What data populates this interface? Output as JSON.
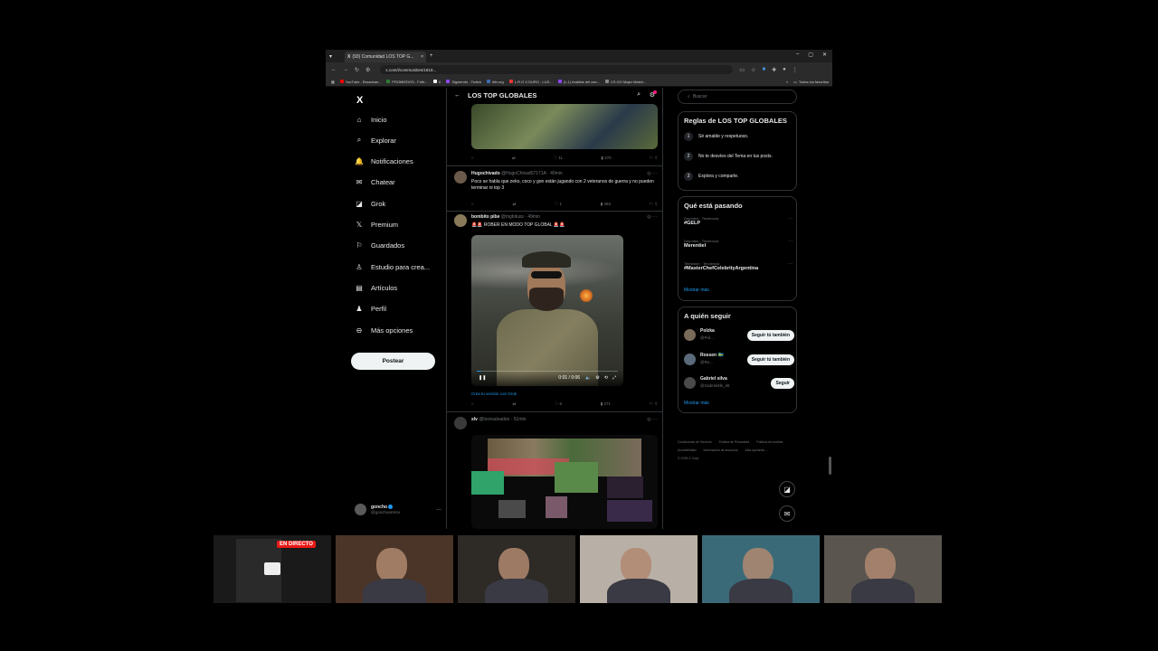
{
  "browser": {
    "tab_title": "(93) Comunidad LOS TOP G...",
    "url": "x.com/i/communities/1818...",
    "bookmarks": [
      {
        "label": "YouTube - Broadcas...",
        "color": "#ff0000"
      },
      {
        "label": "PROMIEDOS - Fútb...",
        "color": "#2e7d32"
      },
      {
        "label": "X",
        "color": "#ffffff"
      },
      {
        "label": "Siguiendo - Twitch",
        "color": "#9146ff"
      },
      {
        "label": "hltv.org",
        "color": "#3d6fb4"
      },
      {
        "label": "L.R.O X DURO - LUS...",
        "color": "#e53935"
      },
      {
        "label": "(1-1) Análisis del can...",
        "color": "#9146ff"
      },
      {
        "label": "CS:GO Major Match...",
        "color": "#888888"
      }
    ],
    "all_bookmarks": "Todos los favoritos"
  },
  "nav": {
    "logo": "X",
    "items": [
      {
        "label": "Inicio",
        "icon": "home-icon",
        "glyph": "⌂"
      },
      {
        "label": "Explorar",
        "icon": "search-icon",
        "glyph": "⌕"
      },
      {
        "label": "Notificaciones",
        "icon": "bell-icon",
        "glyph": "🔔"
      },
      {
        "label": "Chatear",
        "icon": "mail-icon",
        "glyph": "✉"
      },
      {
        "label": "Grok",
        "icon": "grok-icon",
        "glyph": "◪"
      },
      {
        "label": "Premium",
        "icon": "x-premium-icon",
        "glyph": "𝕏"
      },
      {
        "label": "Guardados",
        "icon": "bookmark-icon",
        "glyph": "⚐"
      },
      {
        "label": "Estudio para crea...",
        "icon": "studio-icon",
        "glyph": "♙"
      },
      {
        "label": "Artículos",
        "icon": "article-icon",
        "glyph": "▤"
      },
      {
        "label": "Perfil",
        "icon": "person-icon",
        "glyph": "♟"
      },
      {
        "label": "Más opciones",
        "icon": "more-circle-icon",
        "glyph": "⊖"
      }
    ],
    "post_button": "Postear",
    "account": {
      "name": "goncho",
      "handle": "@gonchoarreso"
    }
  },
  "feed": {
    "title": "LOS TOP GLOBALES",
    "tweets": [
      {
        "author": "",
        "handle": "",
        "time": "",
        "text": "",
        "replies": "",
        "likes": "11",
        "views": "270"
      },
      {
        "author": "Hugochivado",
        "handle": "@HugoChivad07171A",
        "time": "40min",
        "text": "Poco se habla que zeko, coco y gon están jugando con 2 veteranos de guerra y no pueden terminar ni top 3",
        "likes": "1",
        "views": "283"
      },
      {
        "author": "bombito pibe",
        "handle": "@mgbituss",
        "time": "49min",
        "text": "🚨🚨 ROBER EN MODO TOP GLOBAL 🚨🚨",
        "video_time": "0:01 / 0:06",
        "grok_link": "Crea tu versión con Grok",
        "likes": "6",
        "views": "271"
      },
      {
        "author": "slv",
        "handle": "@losvsalvadon",
        "time": "51min",
        "text": ""
      }
    ]
  },
  "sidebar": {
    "search_placeholder": "Buscar",
    "rules_title": "Reglas de LOS TOP GLOBALES",
    "rules": [
      {
        "num": "1",
        "text": "Sé amable y respetuoso."
      },
      {
        "num": "2",
        "text": "No te desvíes del Tema en tus posts."
      },
      {
        "num": "3",
        "text": "Explora y comparte."
      }
    ],
    "trends_title": "Qué está pasando",
    "trends": [
      {
        "meta": "Deportes · Tendencia",
        "name": "#GELP"
      },
      {
        "meta": "Deportes · Tendencia",
        "name": "Merentiel"
      },
      {
        "meta": "Televisión · Tendencia",
        "name": "#MasterChefCelebrityArgentina"
      }
    ],
    "show_more": "Mostrar más",
    "follow_title": "A quién seguir",
    "follow": [
      {
        "name": "Polzka",
        "handle": "@Pol...",
        "button": "Seguir tú también"
      },
      {
        "name": "Rossen 🇸🇪",
        "handle": "@Ro...",
        "button": "Seguir tú también"
      },
      {
        "name": "Gabriel silva",
        "handle": "@Gabriel4lk_46",
        "button": "Seguir"
      }
    ],
    "footer": [
      "Condiciones de Servicio",
      "Política de Privacidad",
      "Política de cookies",
      "Accesibilidad",
      "Información de anuncios",
      "Más opciones ...",
      "© 2025 X Corp."
    ]
  },
  "streams": {
    "live_badge": "EN DIRECTO",
    "cams": [
      {
        "name": "cam-screen",
        "bg": "#1a1a1a"
      },
      {
        "name": "cam-2",
        "bg": "#4a3528"
      },
      {
        "name": "cam-3",
        "bg": "#2e2a26"
      },
      {
        "name": "cam-4",
        "bg": "#b8b0a6"
      },
      {
        "name": "cam-5",
        "bg": "#3a6a78"
      },
      {
        "name": "cam-6",
        "bg": "#5a554f"
      }
    ]
  }
}
